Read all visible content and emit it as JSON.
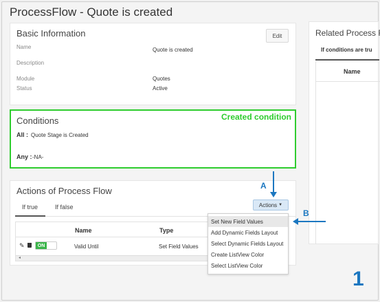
{
  "page": {
    "title": "ProcessFlow - Quote is created"
  },
  "basic_info": {
    "title": "Basic Information",
    "edit_label": "Edit",
    "fields": [
      {
        "label": "Name",
        "value": "Quote is created"
      },
      {
        "label": "Description",
        "value": ""
      },
      {
        "label": "Module",
        "value": "Quotes"
      },
      {
        "label": "Status",
        "value": "Active"
      }
    ]
  },
  "conditions": {
    "title": "Conditions",
    "all_label": "All :",
    "all_value": "Quote Stage is Created",
    "any_label": "Any :",
    "any_value": "-NA-",
    "callout": "Created condition"
  },
  "actions": {
    "title": "Actions of Process Flow",
    "tabs": [
      "If true",
      "If false"
    ],
    "button_label": "Actions",
    "columns": [
      "Name",
      "Type"
    ],
    "rows": [
      {
        "toggle": "ON",
        "name": "Valid Until",
        "type": "Set Field Values"
      }
    ],
    "menu_items": [
      "Set New Field Values",
      "Add Dynamic Fields Layout",
      "Select Dynamic Fields Layout",
      "Create ListView Color",
      "Select ListView Color"
    ]
  },
  "related": {
    "title": "Related Process F",
    "tab_label": "If conditions are tru",
    "column": "Name"
  },
  "annotations": {
    "a": "A",
    "b": "B",
    "step": "1"
  },
  "colors": {
    "callout_green": "#2ecc2e",
    "callout_blue": "#1b77c0",
    "toggle_on": "#3bb54a"
  },
  "icons": [
    "pencil-icon",
    "trash-icon",
    "caret-down-icon",
    "arrow-down-icon",
    "arrow-left-icon"
  ]
}
